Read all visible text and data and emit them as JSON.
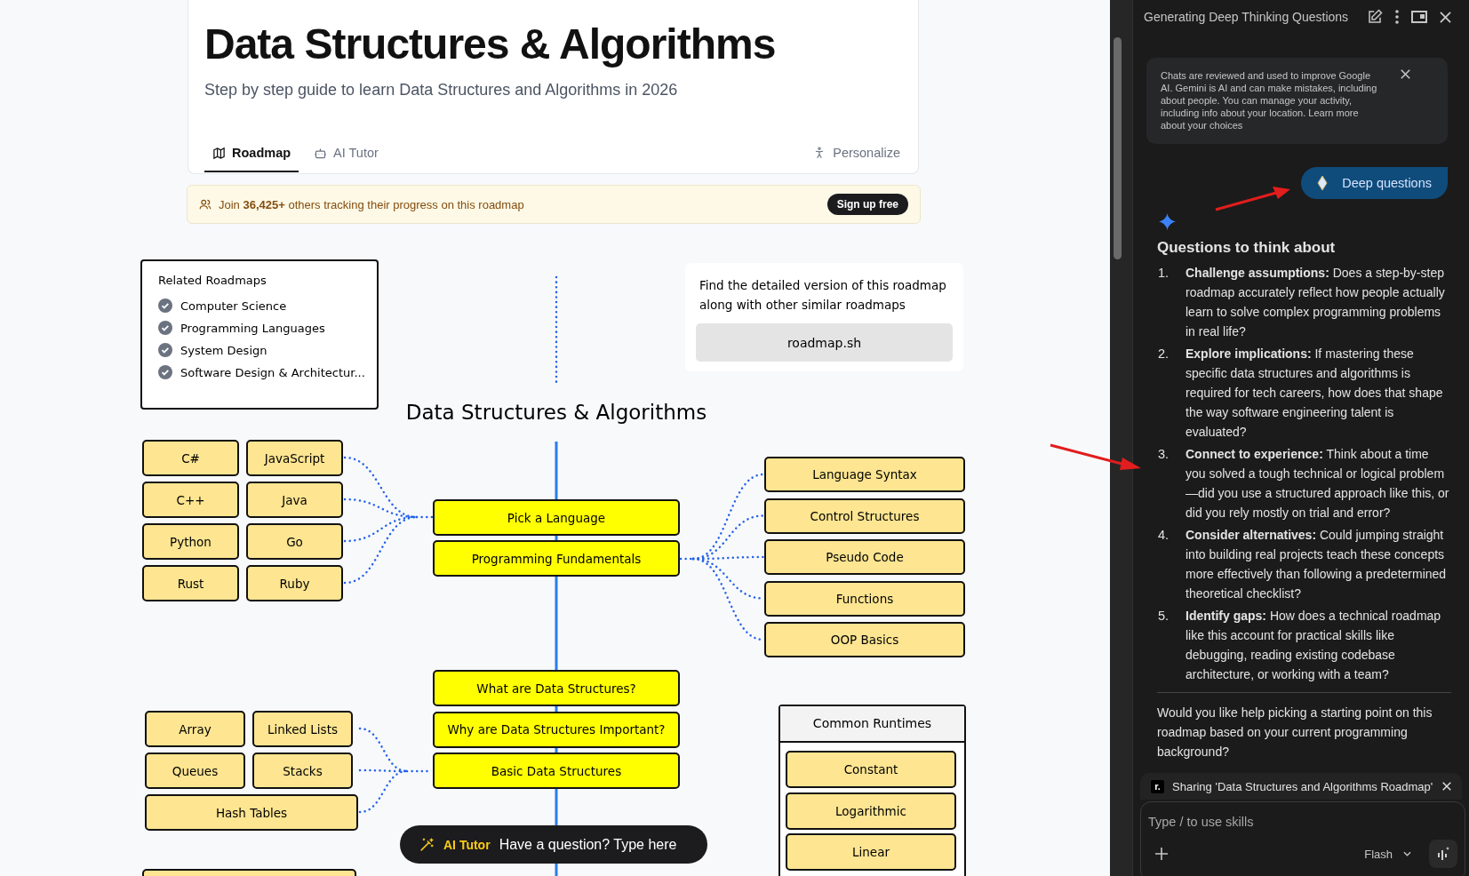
{
  "page": {
    "title": "Data Structures & Algorithms",
    "subtitle": "Step by step guide to learn Data Structures and Algorithms in 2026",
    "tabs": [
      {
        "label": "Roadmap",
        "selected": true
      },
      {
        "label": "AI Tutor",
        "selected": false
      }
    ],
    "personalize": "Personalize",
    "banner": {
      "text": "Join **36,425+** others tracking their progress on this roadmap",
      "button": "Sign up free"
    }
  },
  "roadmap": {
    "related": {
      "title": "Related Roadmaps",
      "items": [
        "Computer Science",
        "Programming Languages",
        "System Design",
        "Software Design & Architectur..."
      ]
    },
    "promo": {
      "text": "Find the detailed version of this roadmap along with other similar roadmaps",
      "button": "roadmap.sh"
    },
    "title": "Data Structures & Algorithms",
    "languages": [
      "C#",
      "JavaScript",
      "C++",
      "Java",
      "Python",
      "Go",
      "Rust",
      "Ruby"
    ],
    "main_topics": [
      "Pick a Language",
      "Programming Fundamentals"
    ],
    "fundamentals": [
      "Language Syntax",
      "Control Structures",
      "Pseudo Code",
      "Functions",
      "OOP Basics"
    ],
    "ds_topics": [
      "What are Data Structures?",
      "Why are Data Structures Important?",
      "Basic Data Structures"
    ],
    "data_structures": [
      "Array",
      "Linked Lists",
      "Queues",
      "Stacks",
      "Hash Tables"
    ],
    "runtimes": {
      "title": "Common Runtimes",
      "items": [
        "Constant",
        "Logarithmic",
        "Linear"
      ]
    }
  },
  "ai_tutor": {
    "label": "AI Tutor",
    "placeholder": "Have a question? Type here"
  },
  "panel": {
    "title": "Generating Deep Thinking Questions",
    "notice": "Chats are reviewed and used to improve Google AI. Gemini is AI and can make mistakes, including about people. You can manage your activity, including info about your location. Learn more about your choices",
    "user_chip": "Deep questions",
    "heading": "Questions to think about",
    "questions": [
      {
        "number": "1.",
        "text": "**Challenge assumptions:** Does a step-by-step roadmap accurately reflect how people actually learn to solve complex programming problems in real life?"
      },
      {
        "number": "2.",
        "text": "**Explore implications:** If mastering these specific data structures and algorithms is required for tech careers, how does that shape the way software engineering talent is evaluated?"
      },
      {
        "number": "3.",
        "text": "**Connect to experience:** Think about a time you solved a tough technical or logical problem—did you use a structured approach like this, or did you rely mostly on trial and error?"
      },
      {
        "number": "4.",
        "text": "**Consider alternatives:** Could jumping straight into building real projects teach these concepts more effectively than following a predetermined theoretical checklist?"
      },
      {
        "number": "5.",
        "text": "**Identify gaps:** How does a technical roadmap like this account for practical skills like debugging, reading existing codebase architecture, or working with a team?"
      }
    ],
    "followup": "Would you like help picking a starting point on this roadmap based on your current programming background?",
    "sharing": {
      "logo": "r.",
      "text": "Sharing 'Data Structures and Algorithms Roadmap'"
    },
    "input": {
      "placeholder": "Type / to use skills",
      "model": "Flash"
    }
  }
}
